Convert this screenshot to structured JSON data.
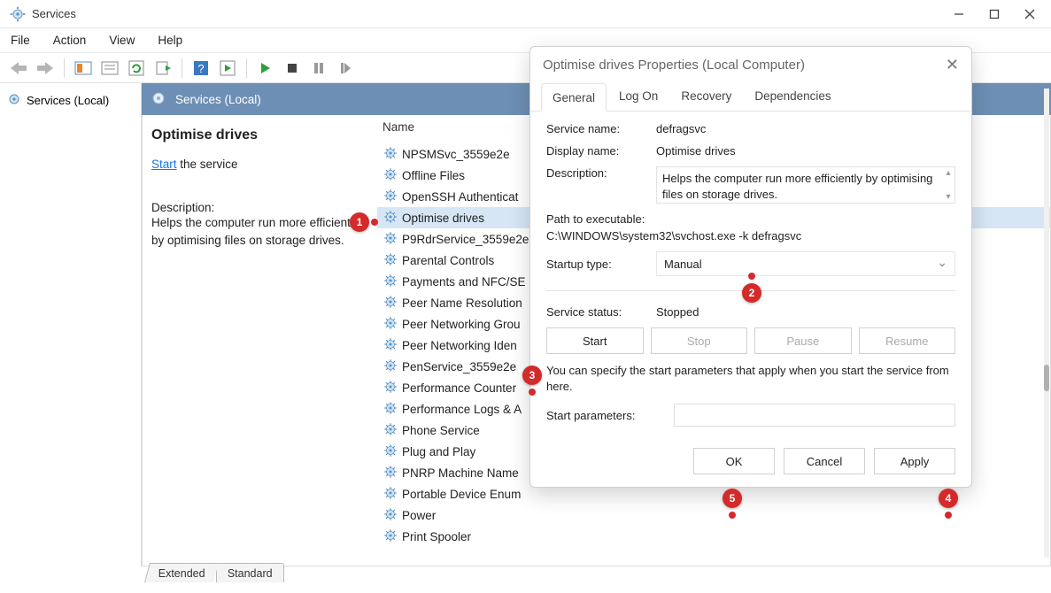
{
  "window": {
    "title": "Services"
  },
  "menubar": {
    "items": [
      "File",
      "Action",
      "View",
      "Help"
    ]
  },
  "tree": {
    "node": "Services (Local)"
  },
  "content": {
    "header": "Services (Local)",
    "sel_title": "Optimise drives",
    "start_link": "Start",
    "start_suffix": " the service",
    "desc_label": "Description:",
    "desc_text": "Helps the computer run more efficiently by optimising files on storage drives.",
    "list_header": "Name",
    "items": [
      "NPSMSvc_3559e2e",
      "Offline Files",
      "OpenSSH Authenticat",
      "Optimise drives",
      "P9RdrService_3559e2e",
      "Parental Controls",
      "Payments and NFC/SE",
      "Peer Name Resolution",
      "Peer Networking Grou",
      "Peer Networking Iden",
      "PenService_3559e2e",
      "Performance Counter",
      "Performance Logs & A",
      "Phone Service",
      "Plug and Play",
      "PNRP Machine Name",
      "Portable Device Enum",
      "Power",
      "Print Spooler"
    ],
    "selected_index": 3,
    "tabs": [
      "Extended",
      "Standard"
    ]
  },
  "dialog": {
    "title": "Optimise drives Properties (Local Computer)",
    "tabs": [
      "General",
      "Log On",
      "Recovery",
      "Dependencies"
    ],
    "active_tab": 0,
    "svc_name_k": "Service name:",
    "svc_name_v": "defragsvc",
    "disp_name_k": "Display name:",
    "disp_name_v": "Optimise drives",
    "desc_k": "Description:",
    "desc_v": "Helps the computer run more efficiently by optimising files on storage drives.",
    "path_k": "Path to executable:",
    "path_v": "C:\\WINDOWS\\system32\\svchost.exe -k defragsvc",
    "startup_k": "Startup type:",
    "startup_v": "Manual",
    "status_k": "Service status:",
    "status_v": "Stopped",
    "btn_start": "Start",
    "btn_stop": "Stop",
    "btn_pause": "Pause",
    "btn_resume": "Resume",
    "note": "You can specify the start parameters that apply when you start the service from here.",
    "param_k": "Start parameters:",
    "btn_ok": "OK",
    "btn_cancel": "Cancel",
    "btn_apply": "Apply"
  },
  "callouts": {
    "c1": "1",
    "c2": "2",
    "c3": "3",
    "c4": "4",
    "c5": "5"
  }
}
